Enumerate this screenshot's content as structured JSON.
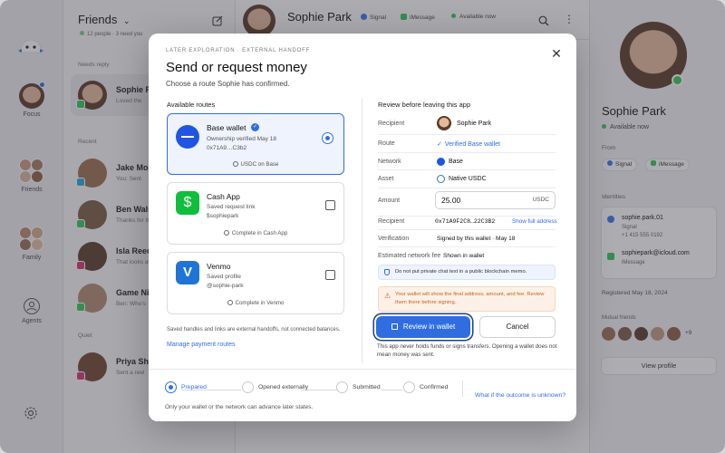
{
  "window": {
    "traffic_lights": [
      "#ff5f57",
      "#febc2e",
      "#28c840"
    ]
  },
  "rail": {
    "items": [
      {
        "label": "Focus"
      },
      {
        "label": "Friends"
      },
      {
        "label": "Family"
      },
      {
        "label": "Agents"
      }
    ]
  },
  "list": {
    "title": "Friends",
    "meta": "12 people · 3 need you",
    "section_needs_reply": "Needs reply",
    "section_recent": "Recent",
    "section_quiet": "Quiet",
    "chats": [
      {
        "name": "Sophie Park",
        "preview": "Loved the"
      },
      {
        "name": "Jake More",
        "preview": "You: Sent"
      },
      {
        "name": "Ben Walsh",
        "preview": "Thanks for th"
      },
      {
        "name": "Isla Reed",
        "preview": "That looks aw"
      },
      {
        "name": "Game Nig",
        "preview": "Ben: Who's"
      },
      {
        "name": "Priya Shah",
        "preview": "Sent a reel"
      }
    ]
  },
  "chat_header": {
    "name": "Sophie Park",
    "badge_signal": "Signal",
    "badge_imessage": "iMessage",
    "status": "Available now"
  },
  "side": {
    "name": "Sophie Park",
    "status": "Available now",
    "from_label": "From",
    "from_signal": "Signal",
    "from_imessage": "iMessage",
    "identities_label": "Identities",
    "identity_1": "sophie.park.01",
    "identity_1_sub": "Signal",
    "identity_1_phone": "+1 415 555 0192",
    "identity_2": "sophiepark@icloud.com",
    "identity_2_sub": "iMessage",
    "registered": "Registered May 18, 2024",
    "mutual_label": "Mutual friends",
    "mutual_more": "+9",
    "view_profile": "View profile"
  },
  "modal": {
    "eyebrow": "LATER EXPLORATION · EXTERNAL HANDOFF",
    "title": "Send or request money",
    "subtitle": "Choose a route Sophie has confirmed.",
    "routes_header": "Available routes",
    "review_header": "Review before leaving this app",
    "routes": [
      {
        "title": "Base wallet",
        "line1": "Ownership verified May 18",
        "line2": "0x71A9…C3b2",
        "foot": "USDC on Base"
      },
      {
        "title": "Cash App",
        "line1": "Saved request link",
        "line2": "$sophiepark",
        "foot": "Complete in Cash App"
      },
      {
        "title": "Venmo",
        "line1": "Saved profile",
        "line2": "@sophie-park",
        "foot": "Complete in Venmo"
      }
    ],
    "routes_note": "Saved handles and links are external handoffs, not connected balances.",
    "manage_link": "Manage payment routes",
    "review": {
      "recipient_label": "Recipient",
      "recipient_value": "Sophie Park",
      "route_label": "Route",
      "route_value": "Verified Base wallet",
      "network_label": "Network",
      "network_value": "Base",
      "asset_label": "Asset",
      "asset_value": "Native USDC",
      "amount_label": "Amount",
      "amount_value": "25.00",
      "amount_unit": "USDC",
      "recipient2_label": "Recipient",
      "recipient2_value": "0x71A9F2C8…22C3B2",
      "show_full": "Show full address",
      "verification_label": "Verification",
      "verification_value": "Signed by this wallet · May 18",
      "fee_label": "Estimated network fee",
      "fee_value": "Shown in wallet",
      "notice": "Do not put private chat text in a public blockchain memo.",
      "warning": "Your wallet will show the final address, amount, and fee. Review them there before signing.",
      "review_btn": "Review in wallet",
      "cancel_btn": "Cancel",
      "disclaimer": "This app never holds funds or signs transfers. Opening a wallet does not mean money was sent."
    },
    "steps": [
      {
        "label": "Prepared"
      },
      {
        "label": "Opened externally"
      },
      {
        "label": "Submitted"
      },
      {
        "label": "Confirmed"
      }
    ],
    "steps_note": "Only your wallet or the network can advance later states.",
    "unknown_link": "What if the outcome is unknown?",
    "colors": {
      "accent": "#2f6de1",
      "warn_bg": "#fdf1e7",
      "warn_text": "#c5621c",
      "info_bg": "#eef3fd"
    }
  }
}
